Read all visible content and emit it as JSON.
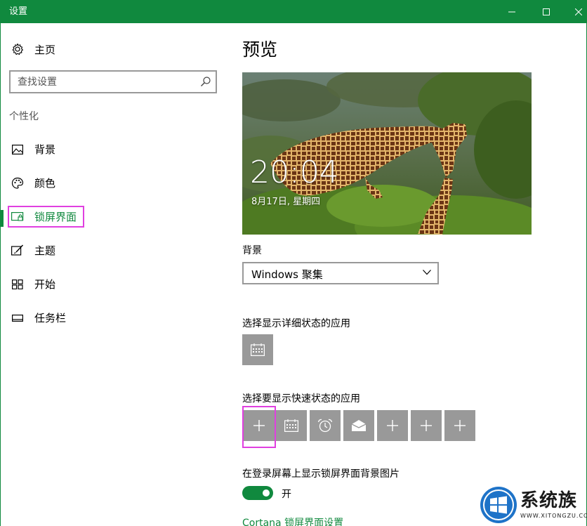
{
  "window": {
    "title": "设置"
  },
  "sidebar": {
    "home_label": "主页",
    "search_placeholder": "查找设置",
    "section_label": "个性化",
    "items": [
      {
        "label": "背景",
        "icon": "image-icon"
      },
      {
        "label": "颜色",
        "icon": "palette-icon"
      },
      {
        "label": "锁屏界面",
        "icon": "lock-screen-icon",
        "active": true
      },
      {
        "label": "主题",
        "icon": "theme-brush-icon"
      },
      {
        "label": "开始",
        "icon": "start-grid-icon"
      },
      {
        "label": "任务栏",
        "icon": "taskbar-icon"
      }
    ]
  },
  "main": {
    "title": "预览",
    "preview": {
      "time": "20:04",
      "date": "8月17日, 星期四"
    },
    "background_label": "背景",
    "background_value": "Windows 聚集",
    "detail_apps_label": "选择显示详细状态的应用",
    "quick_apps_label": "选择要显示快速状态的应用",
    "login_bg_label": "在登录屏幕上显示锁屏界面背景图片",
    "toggle_state": "开",
    "cortana_link": "Cortana 锁屏界面设置"
  },
  "colors": {
    "accent": "#10893e",
    "highlight": "#e040e0",
    "tile": "#999999"
  },
  "watermark": {
    "text": "系统族",
    "sub": "WWW.XITONGZU.COM"
  }
}
